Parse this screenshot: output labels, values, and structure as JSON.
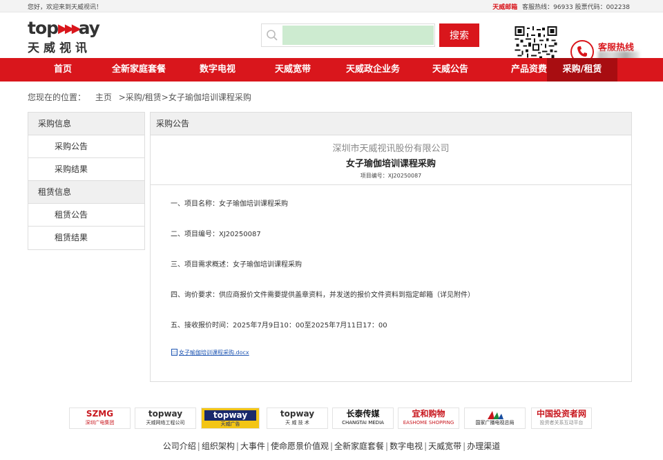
{
  "topbar": {
    "welcome": "您好，欢迎来到天威视讯！",
    "mail": "天威邮箱",
    "hotline": "客服热线：96933",
    "stock": "股票代码：002238"
  },
  "header": {
    "logo_brand": "top",
    "logo_arrows": "▶▶▶",
    "logo_brand_tail": "ay",
    "logo_cn": "天威视讯",
    "search_placeholder": "",
    "search_button": "搜索",
    "hotline_label": "客服热线"
  },
  "nav": {
    "items": [
      "首页",
      "全新家庭套餐",
      "数字电视",
      "天威宽带",
      "天威政企业务",
      "天威公告",
      "产品资费",
      "采购/租赁"
    ]
  },
  "breadcrumb": {
    "prefix": "您现在的位置：",
    "home": "主页",
    "level1": ">采购/租赁",
    "level2": ">女子瑜伽培训课程采购"
  },
  "sidebar": {
    "section1": "采购信息",
    "s1_items": [
      "采购公告",
      "采购结果"
    ],
    "section2": "租赁信息",
    "s2_items": [
      "租赁公告",
      "租赁结果"
    ]
  },
  "content": {
    "header": "采购公告",
    "company": "深圳市天威视讯股份有限公司",
    "title": "女子瑜伽培训课程采购",
    "project_no": "项目编号：XJ20250087",
    "lines": [
      "一、项目名称：女子瑜伽培训课程采购",
      "二、项目编号：XJ20250087",
      "三、项目需求概述：女子瑜伽培训课程采购",
      "四、询价要求：供应商报价文件需要提供盖章资料，并发送的报价文件资料到指定邮箱（详见附件）",
      "五、接收报价时间：2025年7月9日10：00至2025年7月11日17：00"
    ],
    "attachment": "女子瑜伽培训课程采购.docx"
  },
  "partners": [
    {
      "big": "SZMG",
      "small": "深圳广电集团"
    },
    {
      "big": "topway",
      "small": "天威网络工程公司"
    },
    {
      "big": "topway",
      "small": "天威广告"
    },
    {
      "big": "topway",
      "small": "天 威 技 术"
    },
    {
      "big": "长泰传媒",
      "small": "CHANGTAI MEDIA"
    },
    {
      "big": "宜和购物",
      "small": "EASHOME SHOPPING"
    },
    {
      "big": "",
      "small": "国家广播电视总局"
    },
    {
      "big": "中国投资者网",
      "small": "投资者关系互动平台"
    }
  ],
  "footer": {
    "links": [
      "公司介绍",
      "组织架构",
      "大事件",
      "使命愿景价值观",
      "全新家庭套餐",
      "数字电视",
      "天威宽带",
      "办理渠道"
    ]
  },
  "colors": {
    "brand_red": "#d9161c",
    "nav_active": "#a80d11",
    "search_bg": "#cdebd0",
    "link_blue": "#1f56b3"
  }
}
